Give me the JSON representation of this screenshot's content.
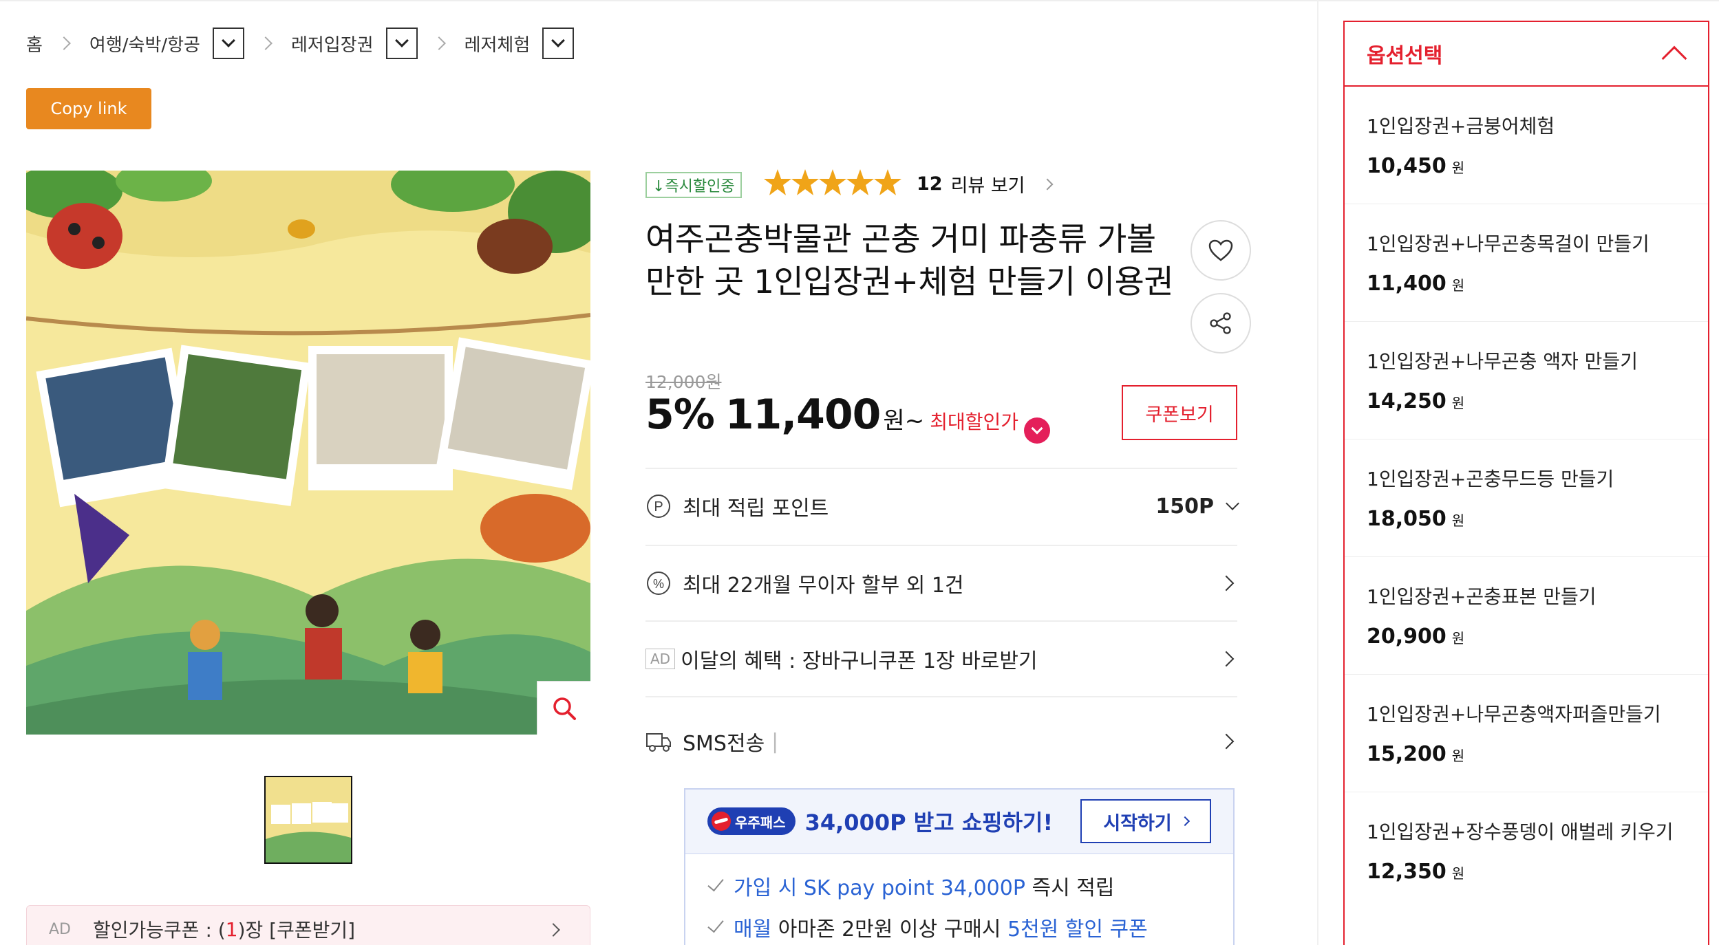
{
  "breadcrumb": {
    "home": "홈",
    "cat1": "여행/숙박/항공",
    "cat2": "레저입장권",
    "cat3": "레저체험"
  },
  "copy_link": "Copy link",
  "coupon_bar": {
    "ad": "AD",
    "prefix": "할인가능쿠폰 : (",
    "count": "1",
    "suffix": ")장 [쿠폰받기]"
  },
  "product": {
    "instant_badge": "↓즉시할인중",
    "rating_stars": 5,
    "review_count": "12",
    "review_label": "리뷰 보기",
    "title": "여주곤충박물관 곤충 거미 파충류 가볼만한 곳 1인입장권+체험 만들기 이용권",
    "original_price": "12,000원",
    "discount": "5%",
    "price": "11,400",
    "won": "원~",
    "max_discount": "최대할인가",
    "coupon_view": "쿠폰보기"
  },
  "info_rows": {
    "points_label": "최대 적립 포인트",
    "points_value": "150P",
    "installment": "최대 22개월 무이자 할부 외 1건",
    "ad": "AD",
    "monthly_benefit": "이달의 혜택 : 장바구니쿠폰 1장 바로받기",
    "sms": "SMS전송",
    "sms_pipe": "|"
  },
  "pass": {
    "badge": "우주패스",
    "title": "34,000P 받고 쇼핑하기!",
    "start": "시작하기",
    "line1_blue": "가입 시 SK pay point 34,000P",
    "line1_rest": " 즉시 적립",
    "line2_blue1": "매월",
    "line2_mid": " 아마존 2만원 이상 구매시 ",
    "line2_blue2": "5천원 할인 쿠폰"
  },
  "options": {
    "header": "옵션선택",
    "won": "원",
    "items": [
      {
        "name": "1인입장권+금붕어체험",
        "price": "10,450"
      },
      {
        "name": "1인입장권+나무곤충목걸이 만들기",
        "price": "11,400"
      },
      {
        "name": "1인입장권+나무곤충 액자 만들기",
        "price": "14,250"
      },
      {
        "name": "1인입장권+곤충무드등 만들기",
        "price": "18,050"
      },
      {
        "name": "1인입장권+곤충표본 만들기",
        "price": "20,900"
      },
      {
        "name": "1인입장권+나무곤충액자퍼즐만들기",
        "price": "15,200"
      },
      {
        "name": "1인입장권+장수풍뎅이 애벌레 키우기",
        "price": "12,350"
      }
    ]
  },
  "colors": {
    "accent_red": "#e4202e",
    "copy_orange": "#e8881f",
    "pass_blue": "#1f3fb3"
  }
}
